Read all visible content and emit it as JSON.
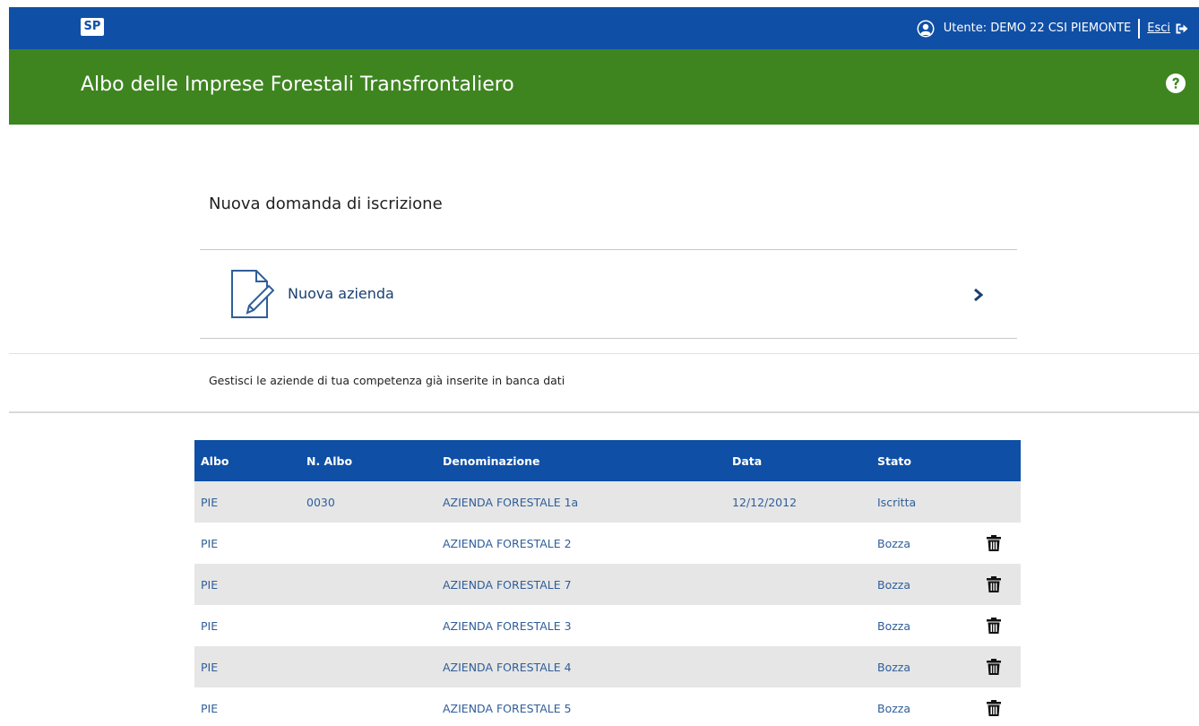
{
  "header": {
    "logo": "SP",
    "user_label": "Utente: DEMO 22 CSI PIEMONTE",
    "logout_label": "Esci",
    "brand_color": "#0f4fa6"
  },
  "banner": {
    "title": "Albo delle Imprese Forestali Transfrontaliero",
    "color": "#3e8520"
  },
  "new_application": {
    "title": "Nuova domanda di iscrizione",
    "new_company_label": "Nuova azienda"
  },
  "manage_text": "Gestisci le aziende di tua competenza già inserite in banca dati",
  "table": {
    "columns": [
      "Albo",
      "N. Albo",
      "Denominazione",
      "Data",
      "Stato"
    ],
    "rows": [
      {
        "albo": "PIE",
        "n_albo": "0030",
        "denominazione": "AZIENDA FORESTALE 1a",
        "data": "12/12/2012",
        "stato": "Iscritta",
        "deletable": false
      },
      {
        "albo": "PIE",
        "n_albo": "",
        "denominazione": "AZIENDA FORESTALE 2",
        "data": "",
        "stato": "Bozza",
        "deletable": true
      },
      {
        "albo": "PIE",
        "n_albo": "",
        "denominazione": "AZIENDA FORESTALE 7",
        "data": "",
        "stato": "Bozza",
        "deletable": true
      },
      {
        "albo": "PIE",
        "n_albo": "",
        "denominazione": "AZIENDA FORESTALE 3",
        "data": "",
        "stato": "Bozza",
        "deletable": true
      },
      {
        "albo": "PIE",
        "n_albo": "",
        "denominazione": "AZIENDA FORESTALE 4",
        "data": "",
        "stato": "Bozza",
        "deletable": true
      },
      {
        "albo": "PIE",
        "n_albo": "",
        "denominazione": "AZIENDA FORESTALE 5",
        "data": "",
        "stato": "Bozza",
        "deletable": true
      }
    ]
  }
}
